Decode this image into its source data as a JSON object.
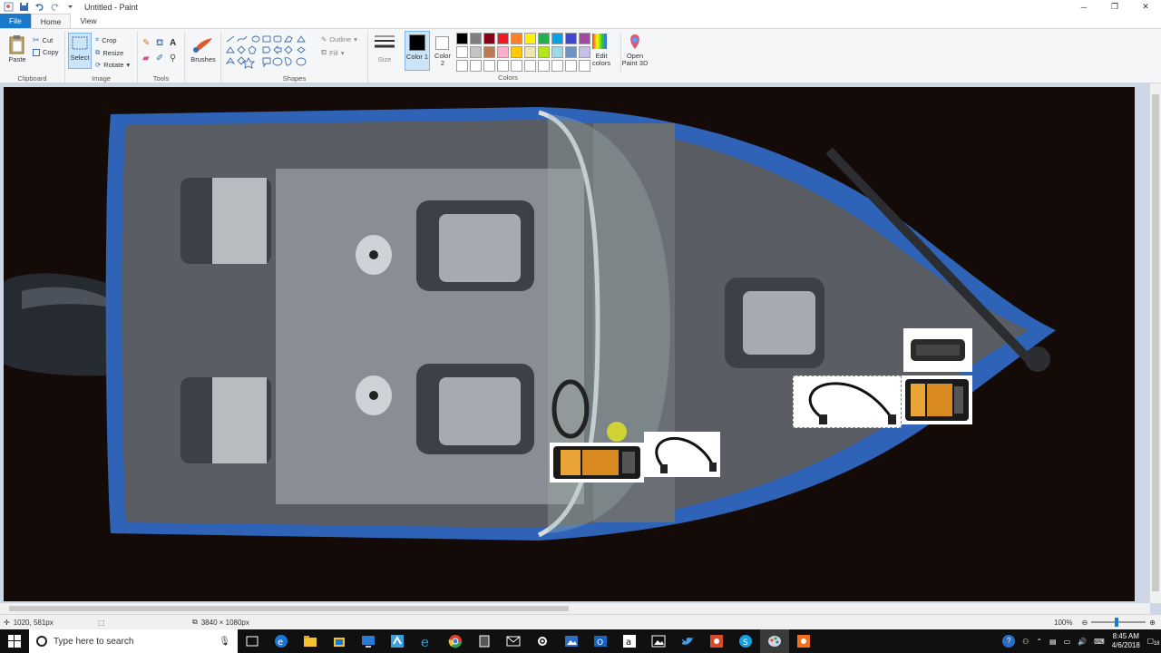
{
  "window": {
    "title": "Untitled - Paint"
  },
  "tabs": {
    "file": "File",
    "home": "Home",
    "view": "View"
  },
  "clipboard": {
    "paste": "Paste",
    "cut": "Cut",
    "copy": "Copy",
    "label": "Clipboard"
  },
  "image": {
    "select": "Select",
    "crop": "Crop",
    "resize": "Resize",
    "rotate": "Rotate",
    "label": "Image"
  },
  "tools": {
    "label": "Tools"
  },
  "brushes": {
    "label": "Brushes"
  },
  "shapes": {
    "label": "Shapes",
    "outline": "Outline",
    "fill": "Fill"
  },
  "size": {
    "label": "Size"
  },
  "colors": {
    "color1": "Color 1",
    "color2": "Color 2",
    "label": "Colors",
    "edit": "Edit colors",
    "paint3d": "Open Paint 3D",
    "palette": [
      "#000000",
      "#7f7f7f",
      "#880015",
      "#ed1c24",
      "#ff7f27",
      "#fff200",
      "#22b14c",
      "#00a2e8",
      "#3f48cc",
      "#a349a4",
      "#ffffff",
      "#c3c3c3",
      "#b97a57",
      "#ffaec9",
      "#ffc90e",
      "#efe4b0",
      "#b5e61d",
      "#99d9ea",
      "#7092be",
      "#c8bfe7",
      "#ffffff",
      "#ffffff",
      "#ffffff",
      "#ffffff",
      "#ffffff",
      "#ffffff",
      "#ffffff",
      "#ffffff",
      "#ffffff",
      "#ffffff"
    ]
  },
  "status": {
    "cursor": "1020, 581px",
    "dimensions": "3840 × 1080px",
    "zoom": "100%"
  },
  "taskbar": {
    "search_placeholder": "Type here to search",
    "time": "8:45 AM",
    "date": "4/6/2018",
    "notifications": "18"
  }
}
